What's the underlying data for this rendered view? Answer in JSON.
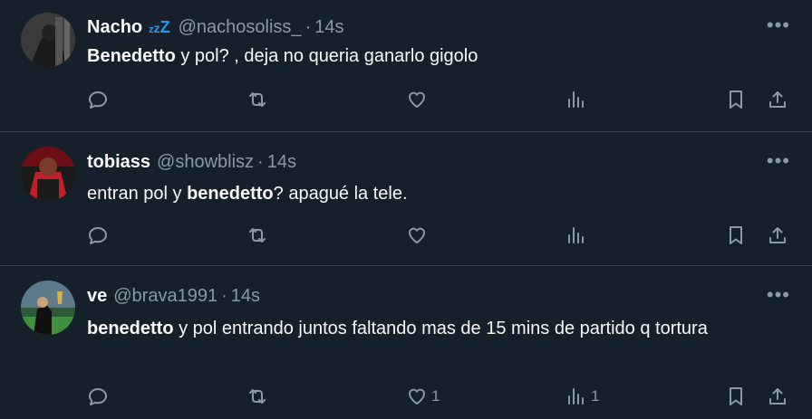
{
  "tweets": [
    {
      "name": "Nacho",
      "zzz": [
        "z",
        "z",
        "Z"
      ],
      "handle": "@nachosoliss_",
      "dot": "·",
      "time": "14s",
      "text_bold": "Benedetto",
      "text_rest": " y pol? , deja no queria ganarlo gigolo",
      "reply_count": "",
      "retweet_count": "",
      "like_count": "",
      "view_count": ""
    },
    {
      "name": "tobiass",
      "handle": "@showblisz",
      "dot": "·",
      "time": "14s",
      "text_pre": "entran pol y ",
      "text_bold": "benedetto",
      "text_rest": "? apagué la tele.",
      "reply_count": "",
      "retweet_count": "",
      "like_count": "",
      "view_count": ""
    },
    {
      "name": "ve",
      "handle": "@brava1991",
      "dot": "·",
      "time": "14s",
      "text_bold": "benedetto",
      "text_rest": " y pol entrando juntos faltando mas de 15 mins de partido q tortura",
      "reply_count": "",
      "retweet_count": "",
      "like_count": "1",
      "view_count": "1"
    }
  ],
  "more_glyph": "•••",
  "colors": {
    "background": "#15202b",
    "text": "#f7f9f9",
    "muted": "#8b98a5",
    "divider": "#38444d",
    "accent": "#1d9bf0"
  }
}
